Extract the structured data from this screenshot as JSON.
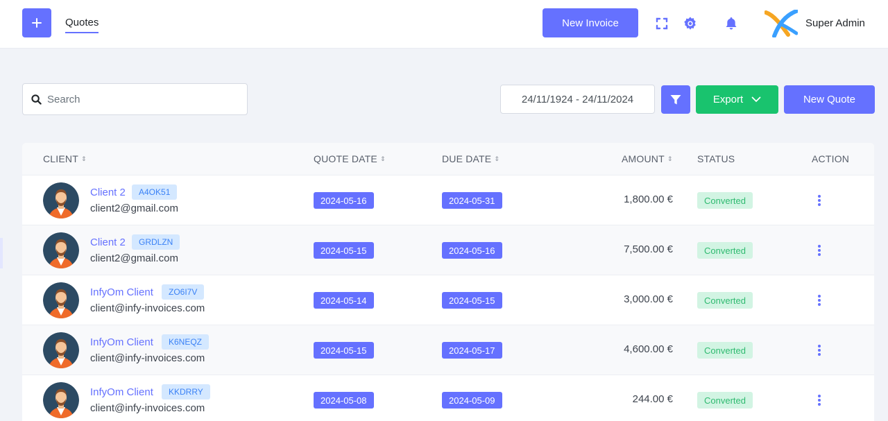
{
  "header": {
    "nav_tab": "Quotes",
    "new_invoice_label": "New Invoice",
    "user_name": "Super Admin"
  },
  "toolbar": {
    "search_placeholder": "Search",
    "date_range": "24/11/1924 - 24/11/2024",
    "export_label": "Export",
    "new_quote_label": "New Quote"
  },
  "table": {
    "columns": {
      "client": "CLIENT",
      "quote_date": "QUOTE DATE",
      "due_date": "DUE DATE",
      "amount": "AMOUNT",
      "status": "STATUS",
      "action": "ACTION"
    },
    "rows": [
      {
        "client": "Client 2",
        "code": "A4OK51",
        "email": "client2@gmail.com",
        "quote_date": "2024-05-16",
        "due_date": "2024-05-31",
        "amount": "1,800.00 €",
        "status": "Converted"
      },
      {
        "client": "Client 2",
        "code": "GRDLZN",
        "email": "client2@gmail.com",
        "quote_date": "2024-05-15",
        "due_date": "2024-05-16",
        "amount": "7,500.00 €",
        "status": "Converted"
      },
      {
        "client": "InfyOm Client",
        "code": "ZO6I7V",
        "email": "client@infy-invoices.com",
        "quote_date": "2024-05-14",
        "due_date": "2024-05-15",
        "amount": "3,000.00 €",
        "status": "Converted"
      },
      {
        "client": "InfyOm Client",
        "code": "K6NEQZ",
        "email": "client@infy-invoices.com",
        "quote_date": "2024-05-15",
        "due_date": "2024-05-17",
        "amount": "4,600.00 €",
        "status": "Converted"
      },
      {
        "client": "InfyOm Client",
        "code": "KKDRRY",
        "email": "client@infy-invoices.com",
        "quote_date": "2024-05-08",
        "due_date": "2024-05-09",
        "amount": "244.00 €",
        "status": "Converted"
      }
    ]
  },
  "colors": {
    "primary": "#6571ff",
    "success": "#19c36e",
    "badge_bg": "#d4e8ff",
    "status_bg": "#d2f4e3"
  },
  "icons": {
    "add": "plus-icon",
    "fullscreen": "fullscreen-icon",
    "settings": "gear-icon",
    "notifications": "bell-icon",
    "search": "search-icon",
    "filter": "filter-icon",
    "export": "chevron-down-icon",
    "row_action": "kebab-menu-icon",
    "avatar": "user-avatar-icon"
  }
}
